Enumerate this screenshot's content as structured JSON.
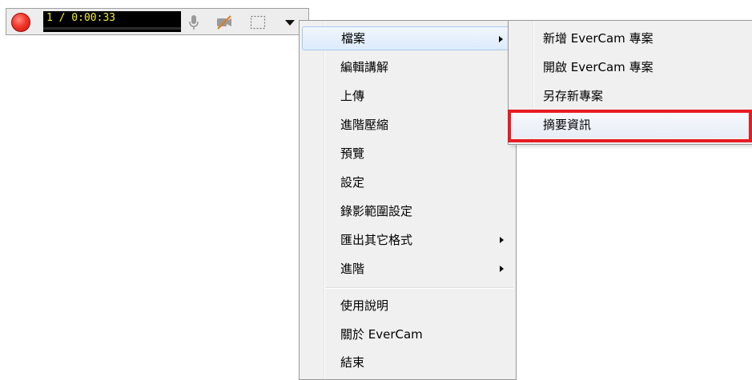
{
  "toolbar": {
    "timer": "1 / 0:00:33",
    "icons": {
      "record": "record-button",
      "mic": "microphone-icon",
      "camera": "camera-off-icon",
      "region": "region-select-icon",
      "menu": "dropdown-arrow-icon"
    },
    "colors": {
      "record": "#f2382c",
      "timer_text": "#f3ea21",
      "timer_bg": "#000000"
    }
  },
  "main_menu": {
    "items": [
      {
        "label": "檔案",
        "has_submenu": true
      },
      {
        "label": "編輯講解"
      },
      {
        "label": "上傳"
      },
      {
        "label": "進階壓縮"
      },
      {
        "label": "預覽"
      },
      {
        "label": "設定"
      },
      {
        "label": "錄影範圍設定"
      },
      {
        "label": "匯出其它格式",
        "has_submenu": true
      },
      {
        "label": "進階",
        "has_submenu": true
      },
      {
        "label": "使用說明"
      },
      {
        "label": "關於 EverCam"
      },
      {
        "label": "結束"
      }
    ]
  },
  "file_submenu": {
    "items": [
      {
        "label": "新增 EverCam 專案"
      },
      {
        "label": "開啟 EverCam 專案"
      },
      {
        "label": "另存新專案"
      },
      {
        "label": "摘要資訊"
      }
    ]
  },
  "highlight_color": "#e81c24"
}
